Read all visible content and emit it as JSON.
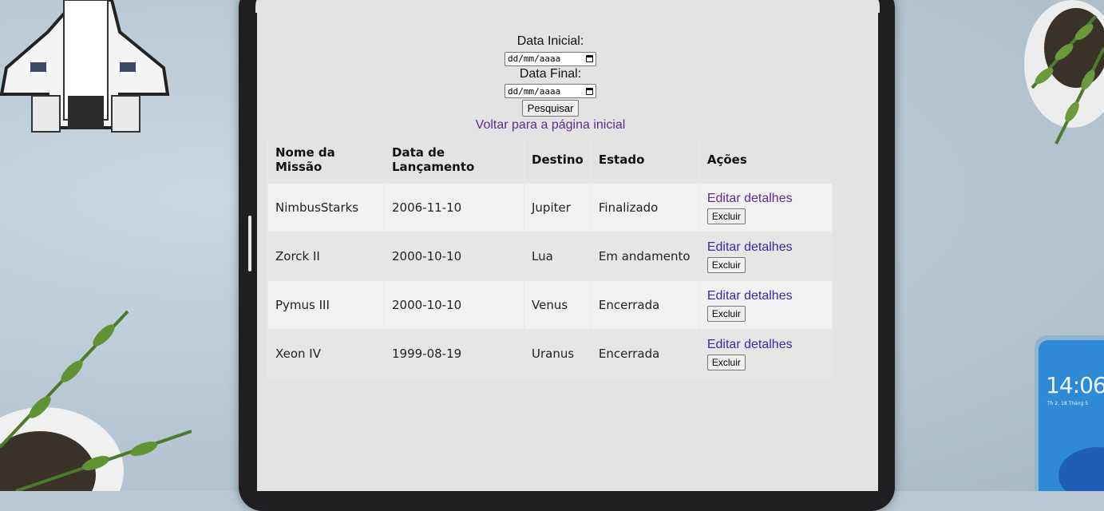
{
  "form": {
    "start_label": "Data Inicial:",
    "start_placeholder": "dd/mm/aaaa",
    "end_label": "Data Final:",
    "end_placeholder": "dd/mm/aaaa",
    "search_button": "Pesquisar",
    "back_link": "Voltar para a página inicial"
  },
  "table": {
    "headers": [
      "Nome da Missão",
      "Data de Lançamento",
      "Destino",
      "Estado",
      "Ações"
    ],
    "rows": [
      {
        "name": "NimbusStarks",
        "date": "2006-11-10",
        "destination": "Jupiter",
        "status": "Finalizado",
        "edit": "Editar detalhes",
        "delete": "Excluir"
      },
      {
        "name": "Zorck II",
        "date": "2000-10-10",
        "destination": "Lua",
        "status": "Em andamento",
        "edit": "Editar detalhes",
        "delete": "Excluir"
      },
      {
        "name": "Pymus III",
        "date": "2000-10-10",
        "destination": "Venus",
        "status": "Encerrada",
        "edit": "Editar detalhes",
        "delete": "Excluir"
      },
      {
        "name": "Xeon IV",
        "date": "1999-08-19",
        "destination": "Uranus",
        "status": "Encerrada",
        "edit": "Editar detalhes",
        "delete": "Excluir"
      }
    ]
  },
  "phone": {
    "time": "14:06",
    "date": "Th 2, 18 Tháng 5"
  },
  "colors": {
    "link_visited": "#5b2d91",
    "link": "#3a2aa6",
    "screen_bg": "#e3e3e3"
  }
}
